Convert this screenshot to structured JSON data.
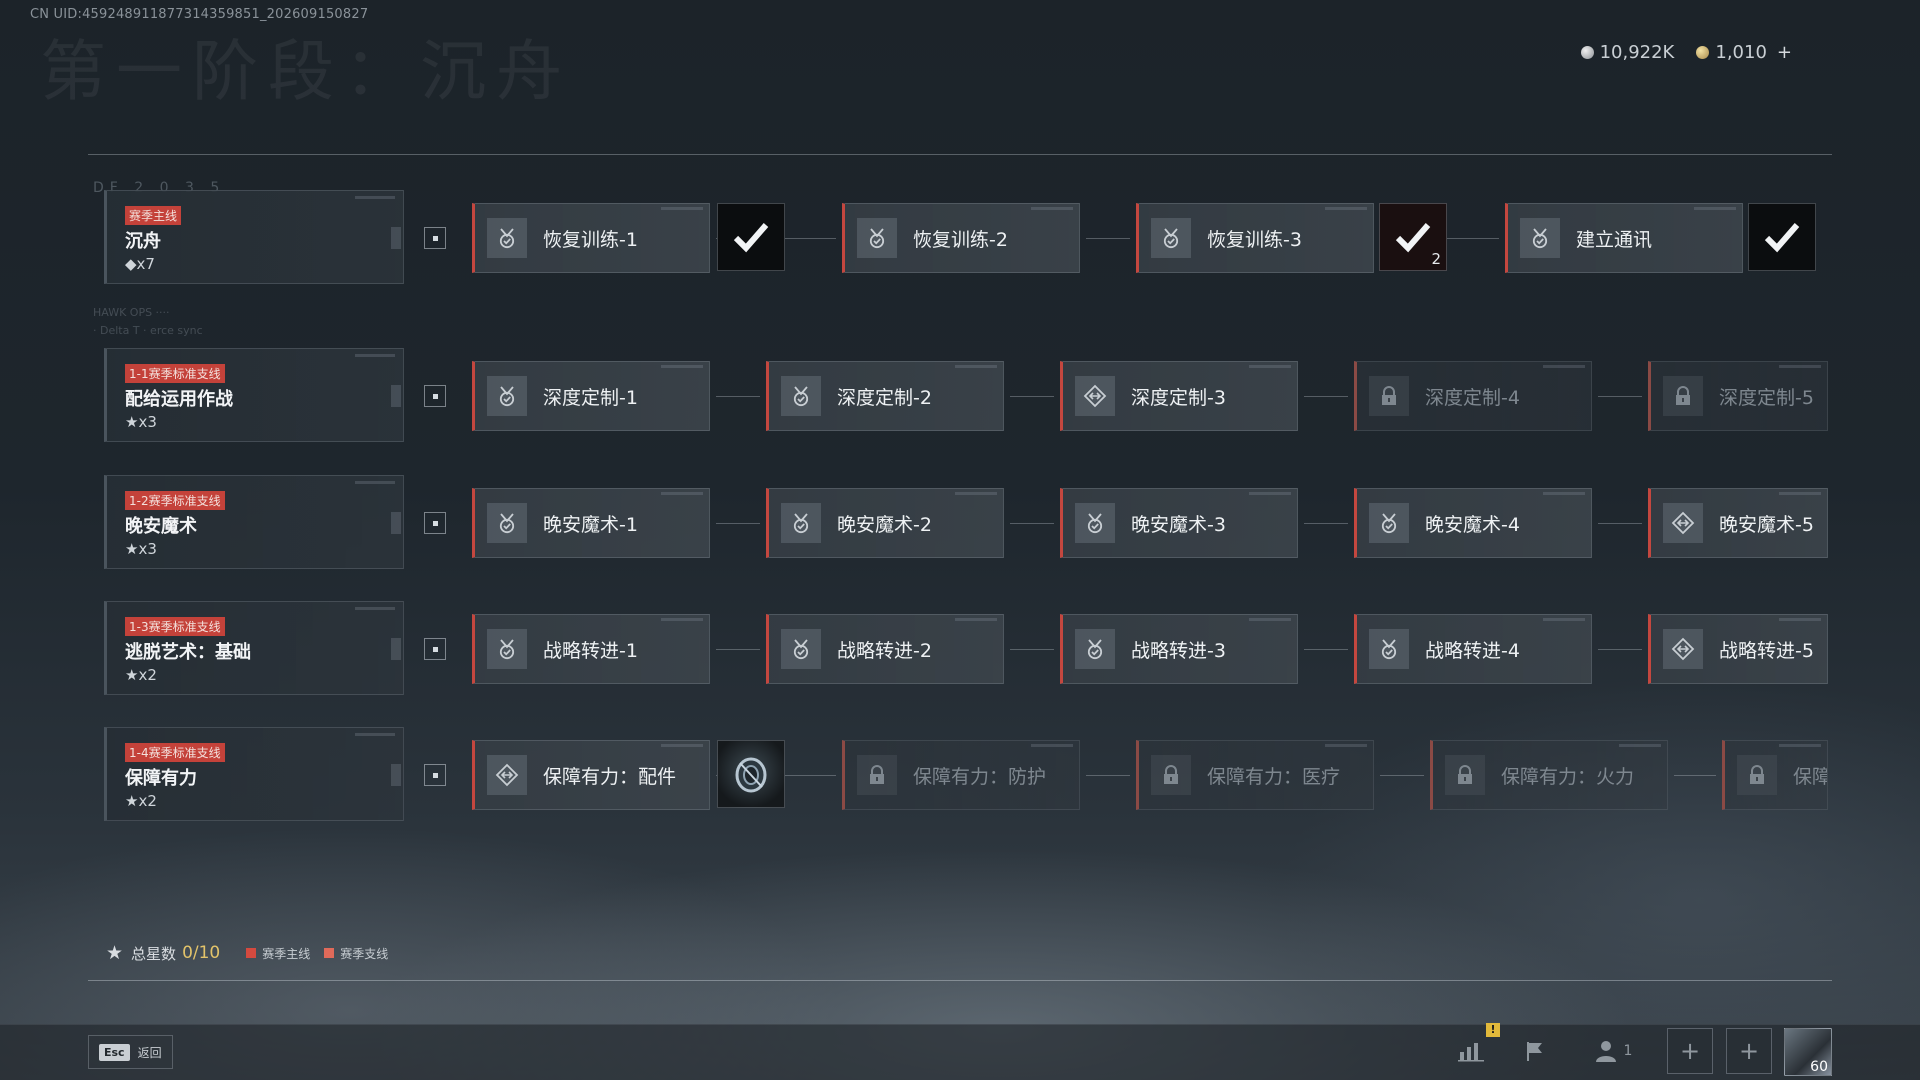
{
  "header": {
    "uid": "CN UID:459248911877314359851_202609150827",
    "ghost_title": "第一阶段：沉舟"
  },
  "currency": {
    "silver": "10,922K",
    "gold": "1,010",
    "plus": "+"
  },
  "side_deco": {
    "code": "DF 2 0 3 5",
    "hawk": "HAWK OPS ····",
    "sub": "· Delta T · erce sync"
  },
  "rows": [
    {
      "tag": "赛季主线",
      "name": "沉舟",
      "reward": "◆x7",
      "nodes": [
        {
          "label": "恢复训练-1",
          "state": "done"
        },
        {
          "label": "恢复训练-2",
          "state": "done"
        },
        {
          "label": "恢复训练-3",
          "state": "done"
        },
        {
          "label": "建立通讯",
          "state": "done"
        }
      ],
      "rewards": [
        {
          "type": "check",
          "count": ""
        },
        {
          "type": "check",
          "count": "2"
        },
        {
          "type": "check",
          "count": ""
        }
      ]
    },
    {
      "tag": "1-1赛季标准支线",
      "name": "配给运用作战",
      "reward": "★x3",
      "nodes": [
        {
          "label": "深度定制-1",
          "state": "done"
        },
        {
          "label": "深度定制-2",
          "state": "done"
        },
        {
          "label": "深度定制-3",
          "state": "active"
        },
        {
          "label": "深度定制-4",
          "state": "locked"
        },
        {
          "label": "深度定制-5",
          "state": "locked"
        }
      ]
    },
    {
      "tag": "1-2赛季标准支线",
      "name": "晚安魔术",
      "reward": "★x3",
      "nodes": [
        {
          "label": "晚安魔术-1",
          "state": "done"
        },
        {
          "label": "晚安魔术-2",
          "state": "done"
        },
        {
          "label": "晚安魔术-3",
          "state": "done"
        },
        {
          "label": "晚安魔术-4",
          "state": "done"
        },
        {
          "label": "晚安魔术-5",
          "state": "active"
        }
      ]
    },
    {
      "tag": "1-3赛季标准支线",
      "name": "逃脱艺术：基础",
      "reward": "★x2",
      "nodes": [
        {
          "label": "战略转进-1",
          "state": "done"
        },
        {
          "label": "战略转进-2",
          "state": "done"
        },
        {
          "label": "战略转进-3",
          "state": "done"
        },
        {
          "label": "战略转进-4",
          "state": "done"
        },
        {
          "label": "战略转进-5",
          "state": "active"
        }
      ]
    },
    {
      "tag": "1-4赛季标准支线",
      "name": "保障有力",
      "reward": "★x2",
      "nodes": [
        {
          "label": "保障有力：配件",
          "state": "active"
        },
        {
          "label": "保障有力：防护",
          "state": "locked"
        },
        {
          "label": "保障有力：医疗",
          "state": "locked"
        },
        {
          "label": "保障有力：火力",
          "state": "locked"
        },
        {
          "label": "保障",
          "state": "locked"
        }
      ],
      "rewards": [
        {
          "type": "item",
          "count": ""
        }
      ]
    }
  ],
  "footer": {
    "total_label": "总星数",
    "total_value": "0/10",
    "legend_main": "赛季主线",
    "legend_side": "赛季支线",
    "legend_main_color": "#d44a3f",
    "legend_side_color": "#e06a5a"
  },
  "bottombar": {
    "esc_key": "Esc",
    "back_label": "返回",
    "squad_count": "1",
    "alert": "!",
    "slot_plus": "+",
    "level": "60"
  },
  "icons": {
    "done": "medal-check-icon",
    "active": "diamond-arrows-icon",
    "locked": "lock-icon"
  },
  "colors": {
    "accent_red": "#c4473f",
    "star_gold": "#e2c36a"
  }
}
